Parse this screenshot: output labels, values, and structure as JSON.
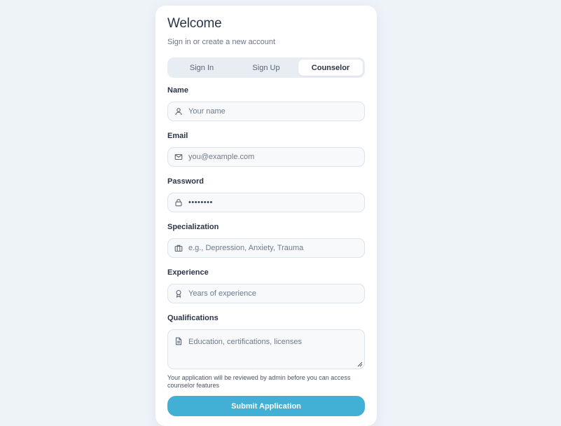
{
  "header": {
    "title": "Welcome",
    "subtitle": "Sign in or create a new account"
  },
  "tabs": [
    {
      "label": "Sign In",
      "active": false
    },
    {
      "label": "Sign Up",
      "active": false
    },
    {
      "label": "Counselor",
      "active": true
    }
  ],
  "form": {
    "name": {
      "label": "Name",
      "placeholder": "Your name",
      "icon": "user-icon"
    },
    "email": {
      "label": "Email",
      "placeholder": "you@example.com",
      "icon": "mail-icon"
    },
    "password": {
      "label": "Password",
      "value": "••••••••",
      "icon": "lock-icon"
    },
    "specialization": {
      "label": "Specialization",
      "placeholder": "e.g., Depression, Anxiety, Trauma",
      "icon": "briefcase-icon"
    },
    "experience": {
      "label": "Experience",
      "placeholder": "Years of experience",
      "icon": "award-icon"
    },
    "qualifications": {
      "label": "Qualifications",
      "placeholder": "Education, certifications, licenses",
      "icon": "document-icon"
    }
  },
  "note": "Your application will be reviewed by admin before you can access counselor features",
  "submit_label": "Submit Application",
  "colors": {
    "accent": "#42b0d5",
    "background": "#eef3f8"
  }
}
